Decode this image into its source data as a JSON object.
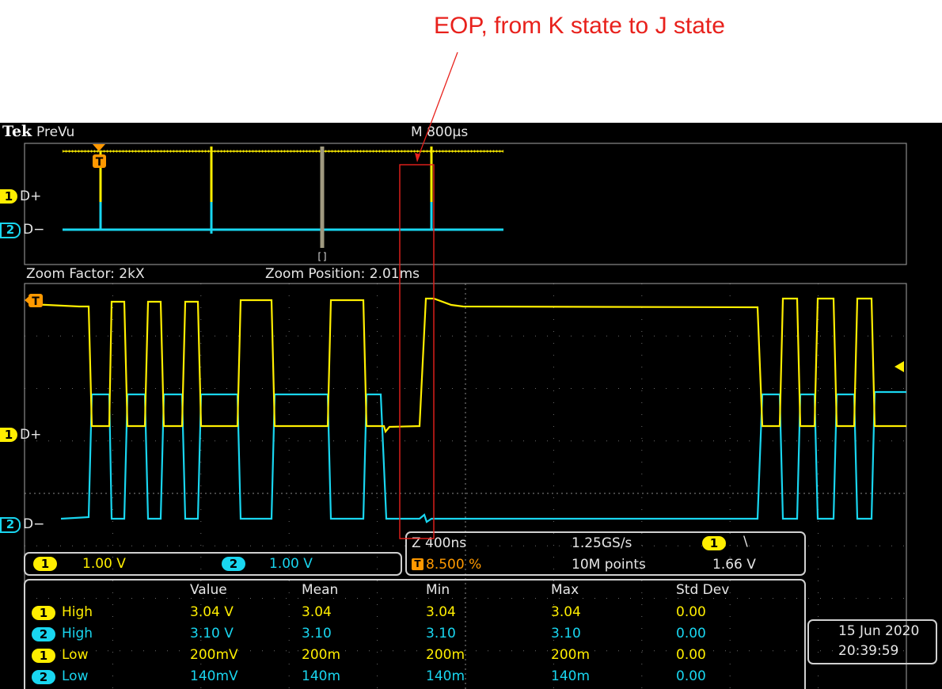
{
  "annotation": {
    "text": "EOP, from K state to J state",
    "color": "#e8211c"
  },
  "header": {
    "brand": "Tek",
    "mode": "PreVu",
    "timebase": "M 800µs"
  },
  "zoom": {
    "factor_text": "Zoom Factor: 2kX",
    "position_text": "Zoom Position: 2.01ms"
  },
  "channels": [
    {
      "num": "1",
      "label": "D+",
      "color": "#ffee00",
      "scale": "1.00 V"
    },
    {
      "num": "2",
      "label": "D−",
      "color": "#19d6f0",
      "scale": "1.00 V"
    }
  ],
  "markers": {
    "trigger": "T",
    "overview_window": "[]"
  },
  "acquisition": {
    "horizontal_scale": "Z 400ns",
    "trigger_position": "8.500 %",
    "sample_rate": "1.25GS/s",
    "record_length": "10M points",
    "trigger_channel": "1",
    "trigger_slope": "\\",
    "trigger_level": "1.66 V"
  },
  "measurements": {
    "headers": [
      "Value",
      "Mean",
      "Min",
      "Max",
      "Std Dev"
    ],
    "rows": [
      {
        "ch": "1",
        "name": "High",
        "value": "3.04 V",
        "mean": "3.04",
        "min": "3.04",
        "max": "3.04",
        "std": "0.00"
      },
      {
        "ch": "2",
        "name": "High",
        "value": "3.10 V",
        "mean": "3.10",
        "min": "3.10",
        "max": "3.10",
        "std": "0.00"
      },
      {
        "ch": "1",
        "name": "Low",
        "value": "200mV",
        "mean": "200m",
        "min": "200m",
        "max": "200m",
        "std": "0.00"
      },
      {
        "ch": "2",
        "name": "Low",
        "value": "140mV",
        "mean": "140m",
        "min": "140m",
        "max": "140m",
        "std": "0.00"
      }
    ]
  },
  "datetime": {
    "date": "15 Jun  2020",
    "time": "20:39:59"
  }
}
